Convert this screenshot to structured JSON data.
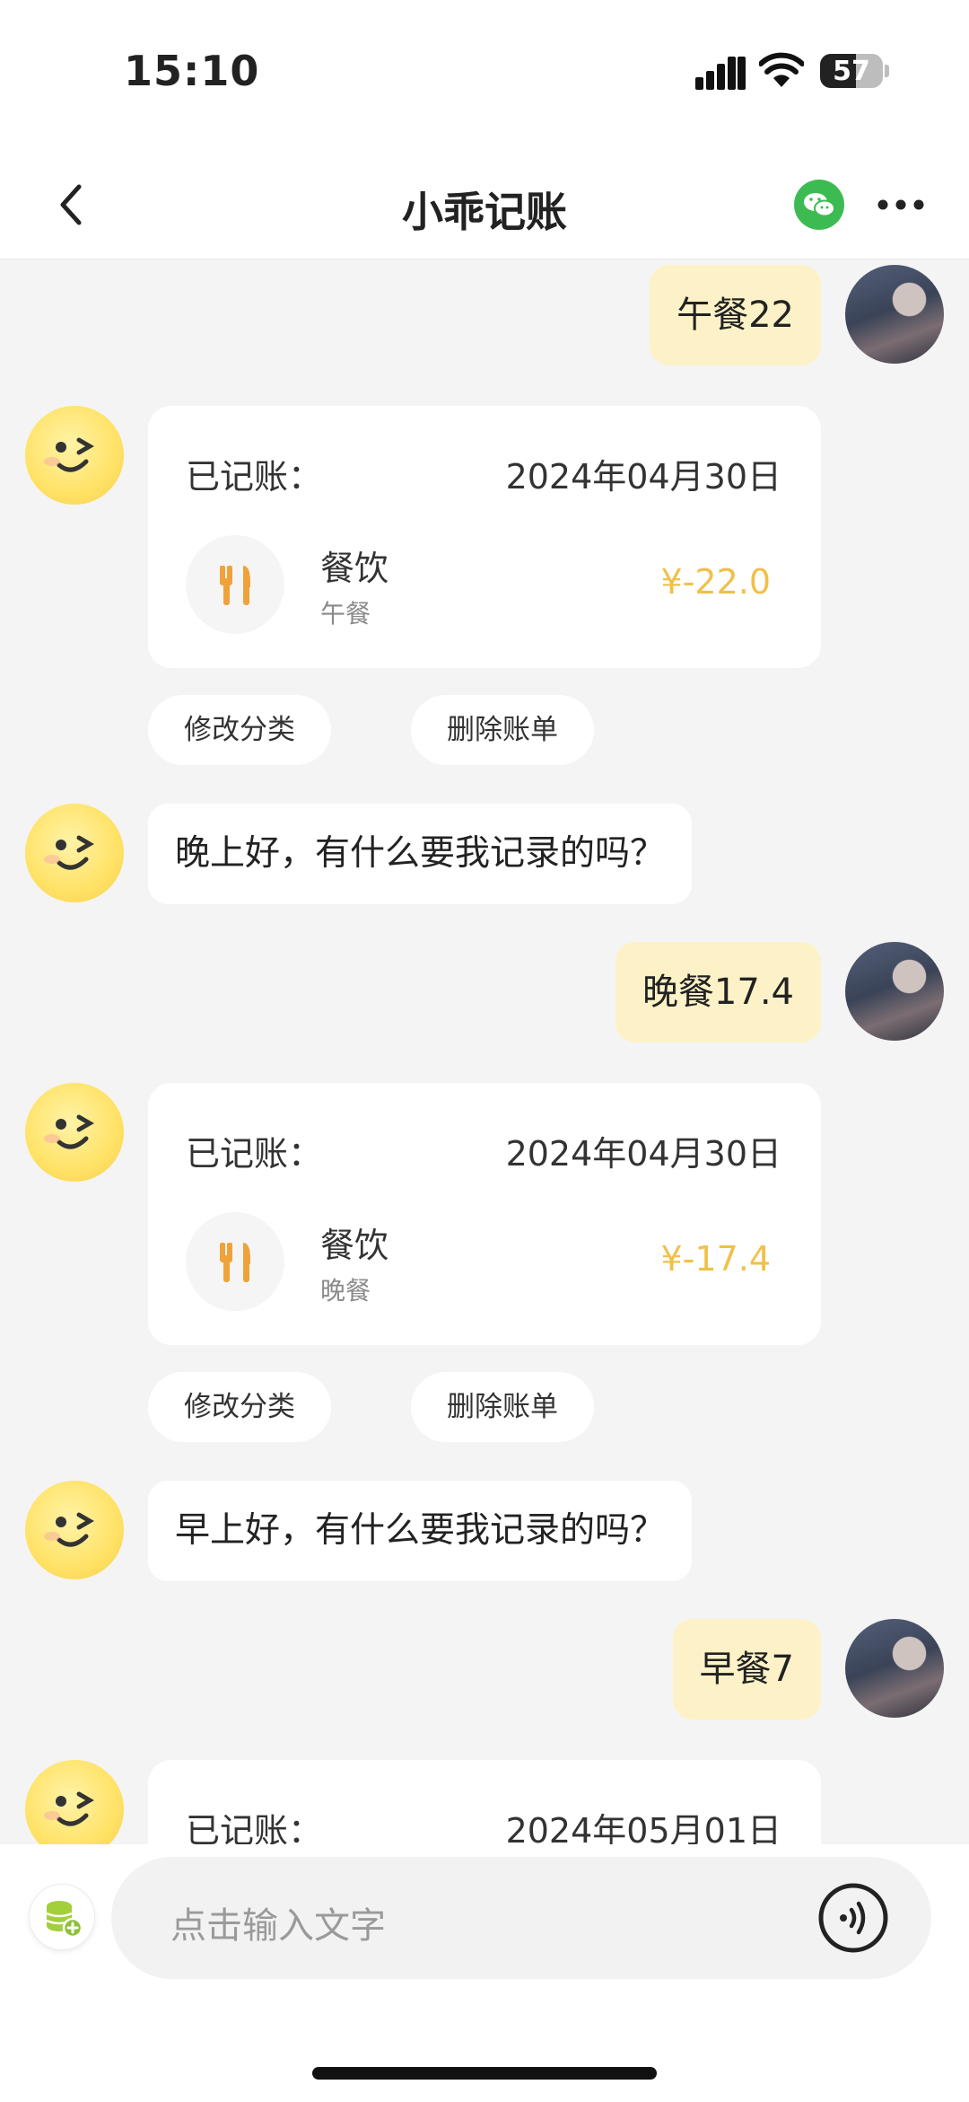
{
  "status_bar": {
    "time": "15:10",
    "battery": "57",
    "battery_level": 0.57
  },
  "nav": {
    "title": "小乖记账",
    "back_icon": "chevron-left-icon",
    "wechat_icon": "wechat-icon",
    "more_icon": "more-dots-icon"
  },
  "messages": {
    "user_1": {
      "text": "午餐22"
    },
    "record_1": {
      "label": "已记账：",
      "date": "2024年04月30日",
      "category": "餐饮",
      "note": "午餐",
      "amount": "¥-22.0",
      "category_icon": "fork-knife-icon"
    },
    "actions_1": {
      "edit": "修改分类",
      "delete": "删除账单"
    },
    "bot_1": {
      "text": "晚上好，有什么要我记录的吗？"
    },
    "user_2": {
      "text": "晚餐17.4"
    },
    "record_2": {
      "label": "已记账：",
      "date": "2024年04月30日",
      "category": "餐饮",
      "note": "晚餐",
      "amount": "¥-17.4",
      "category_icon": "fork-knife-icon"
    },
    "actions_2": {
      "edit": "修改分类",
      "delete": "删除账单"
    },
    "bot_2": {
      "text": "早上好，有什么要我记录的吗？"
    },
    "user_3": {
      "text": "早餐7"
    },
    "record_3": {
      "label": "已记账：",
      "date": "2024年05月01日"
    }
  },
  "input_bar": {
    "placeholder": "点击输入文字",
    "ledger_icon": "database-add-icon",
    "voice_icon": "voice-icon"
  },
  "colors": {
    "accent_yellow": "#fdf2c7",
    "amount_color": "#f0c04a",
    "category_icon_color": "#f0a23a",
    "wechat_green": "#3dbb53"
  }
}
